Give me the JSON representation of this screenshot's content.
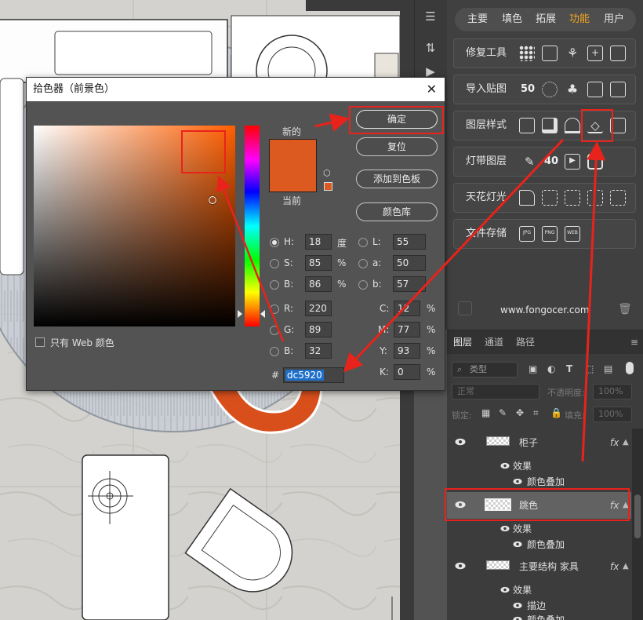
{
  "plugin": {
    "tabs": [
      "主要",
      "填色",
      "拓展",
      "功能",
      "用户"
    ],
    "active_tab": "功能",
    "rows": [
      {
        "label": "修复工具"
      },
      {
        "label": "导入贴图",
        "value": "50"
      },
      {
        "label": "图层样式"
      },
      {
        "label": "灯带图层",
        "value": "40"
      },
      {
        "label": "天花灯光"
      },
      {
        "label": "文件存储"
      }
    ],
    "website": "www.fongocer.com",
    "accent": "#f5a623"
  },
  "layers_panel": {
    "tabs": [
      "图层",
      "通道",
      "路径"
    ],
    "kind_filter": "类型",
    "blend_mode": "正常",
    "opacity_label": "不透明度:",
    "opacity_value": "100%",
    "lock_label": "锁定:",
    "fill_label": "填充:",
    "fill_value": "100%",
    "layers": [
      {
        "name": "柜子",
        "fx": "fx",
        "effects_label": "效果",
        "effects": [
          "颜色叠加"
        ]
      },
      {
        "name": "跳色",
        "fx": "fx",
        "effects_label": "效果",
        "effects": [
          "颜色叠加"
        ],
        "selected": true
      },
      {
        "name": "主要结构 家具",
        "fx": "fx",
        "effects_label": "效果",
        "effects": [
          "描边",
          "颜色叠加"
        ]
      }
    ]
  },
  "color_picker": {
    "title": "拾色器（前景色）",
    "buttons": {
      "ok": "确定",
      "reset": "复位",
      "add_swatch": "添加到色板",
      "libraries": "颜色库"
    },
    "new_label": "新的",
    "current_label": "当前",
    "new_color": "#dc5920",
    "current_color": "#dc5920",
    "web_only_label": "只有 Web 颜色",
    "fields": {
      "H": {
        "label": "H:",
        "value": "18",
        "unit": "度"
      },
      "S": {
        "label": "S:",
        "value": "85",
        "unit": "%"
      },
      "B": {
        "label": "B:",
        "value": "86",
        "unit": "%"
      },
      "L": {
        "label": "L:",
        "value": "55"
      },
      "a": {
        "label": "a:",
        "value": "50"
      },
      "b": {
        "label": "b:",
        "value": "57"
      },
      "R": {
        "label": "R:",
        "value": "220"
      },
      "G": {
        "label": "G:",
        "value": "89"
      },
      "Bl": {
        "label": "B:",
        "value": "32"
      },
      "C": {
        "label": "C:",
        "value": "12",
        "unit": "%"
      },
      "M": {
        "label": "M:",
        "value": "77",
        "unit": "%"
      },
      "Y": {
        "label": "Y:",
        "value": "93",
        "unit": "%"
      },
      "K": {
        "label": "K:",
        "value": "0",
        "unit": "%"
      }
    },
    "hex_label": "#",
    "hex_value": "dc5920"
  },
  "annotation_color": "#e8231b"
}
